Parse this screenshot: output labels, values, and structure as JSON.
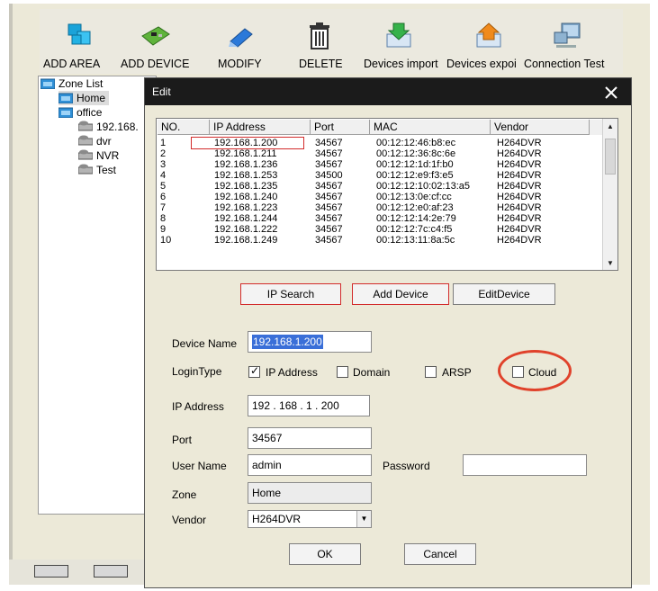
{
  "toolbar": {
    "items": [
      {
        "label": "ADD AREA",
        "icon": "add-area-icon"
      },
      {
        "label": "ADD DEVICE",
        "icon": "add-device-icon"
      },
      {
        "label": "MODIFY",
        "icon": "modify-icon"
      },
      {
        "label": "DELETE",
        "icon": "trash-icon"
      },
      {
        "label": "Devices import",
        "icon": "import-icon"
      },
      {
        "label": "Devices expoi",
        "icon": "export-icon"
      },
      {
        "label": "Connection  Test",
        "icon": "connection-test-icon"
      }
    ]
  },
  "tree": {
    "root": "Zone List",
    "nodes": [
      "Home",
      "office",
      "192.168.",
      "dvr",
      "NVR",
      "Test"
    ]
  },
  "dialog": {
    "title": "Edit",
    "list": {
      "headers": [
        "NO.",
        "IP Address",
        "Port",
        "MAC",
        "Vendor"
      ],
      "rows": [
        [
          "1",
          "192.168.1.200",
          "34567",
          "00:12:12:46:b8:ec",
          "H264DVR"
        ],
        [
          "2",
          "192.168.1.211",
          "34567",
          "00:12:12:36:8c:6e",
          "H264DVR"
        ],
        [
          "3",
          "192.168.1.236",
          "34567",
          "00:12:12:1d:1f:b0",
          "H264DVR"
        ],
        [
          "4",
          "192.168.1.253",
          "34500",
          "00:12:12:e9:f3:e5",
          "H264DVR"
        ],
        [
          "5",
          "192.168.1.235",
          "34567",
          "00:12:12:10:02:13:a5",
          "H264DVR"
        ],
        [
          "6",
          "192.168.1.240",
          "34567",
          "00:12:13:0e:cf:cc",
          "H264DVR"
        ],
        [
          "7",
          "192.168.1.223",
          "34567",
          "00:12:12:e0:af:23",
          "H264DVR"
        ],
        [
          "8",
          "192.168.1.244",
          "34567",
          "00:12:12:14:2e:79",
          "H264DVR"
        ],
        [
          "9",
          "192.168.1.222",
          "34567",
          "00:12:12:7c:c4:f5",
          "H264DVR"
        ],
        [
          "10",
          "192.168.1.249",
          "34567",
          "00:12:13:11:8a:5c",
          "H264DVR"
        ]
      ]
    },
    "buttons": {
      "ip_search": "IP Search",
      "add_device": "Add Device",
      "edit_device": "EditDevice",
      "ok": "OK",
      "cancel": "Cancel"
    },
    "form": {
      "device_name_label": "Device Name",
      "device_name_value": "192.168.1.200",
      "login_type_label": "LoginType",
      "login_options": [
        {
          "label": "IP Address",
          "checked": true
        },
        {
          "label": "Domain",
          "checked": false
        },
        {
          "label": "ARSP",
          "checked": false
        },
        {
          "label": "Cloud",
          "checked": false
        }
      ],
      "ip_address_label": "IP Address",
      "ip_address_value": "192 . 168 .  1  . 200",
      "port_label": "Port",
      "port_value": "34567",
      "user_name_label": "User Name",
      "user_name_value": "admin",
      "password_label": "Password",
      "password_value": "",
      "zone_label": "Zone",
      "zone_value": "Home",
      "vendor_label": "Vendor",
      "vendor_value": "H264DVR"
    }
  },
  "colors": {
    "highlight_red": "#d22b2b",
    "annotation_oval": "#e0422b",
    "selection_blue": "#3a6fd8",
    "titlebar": "#1b1b1b"
  }
}
